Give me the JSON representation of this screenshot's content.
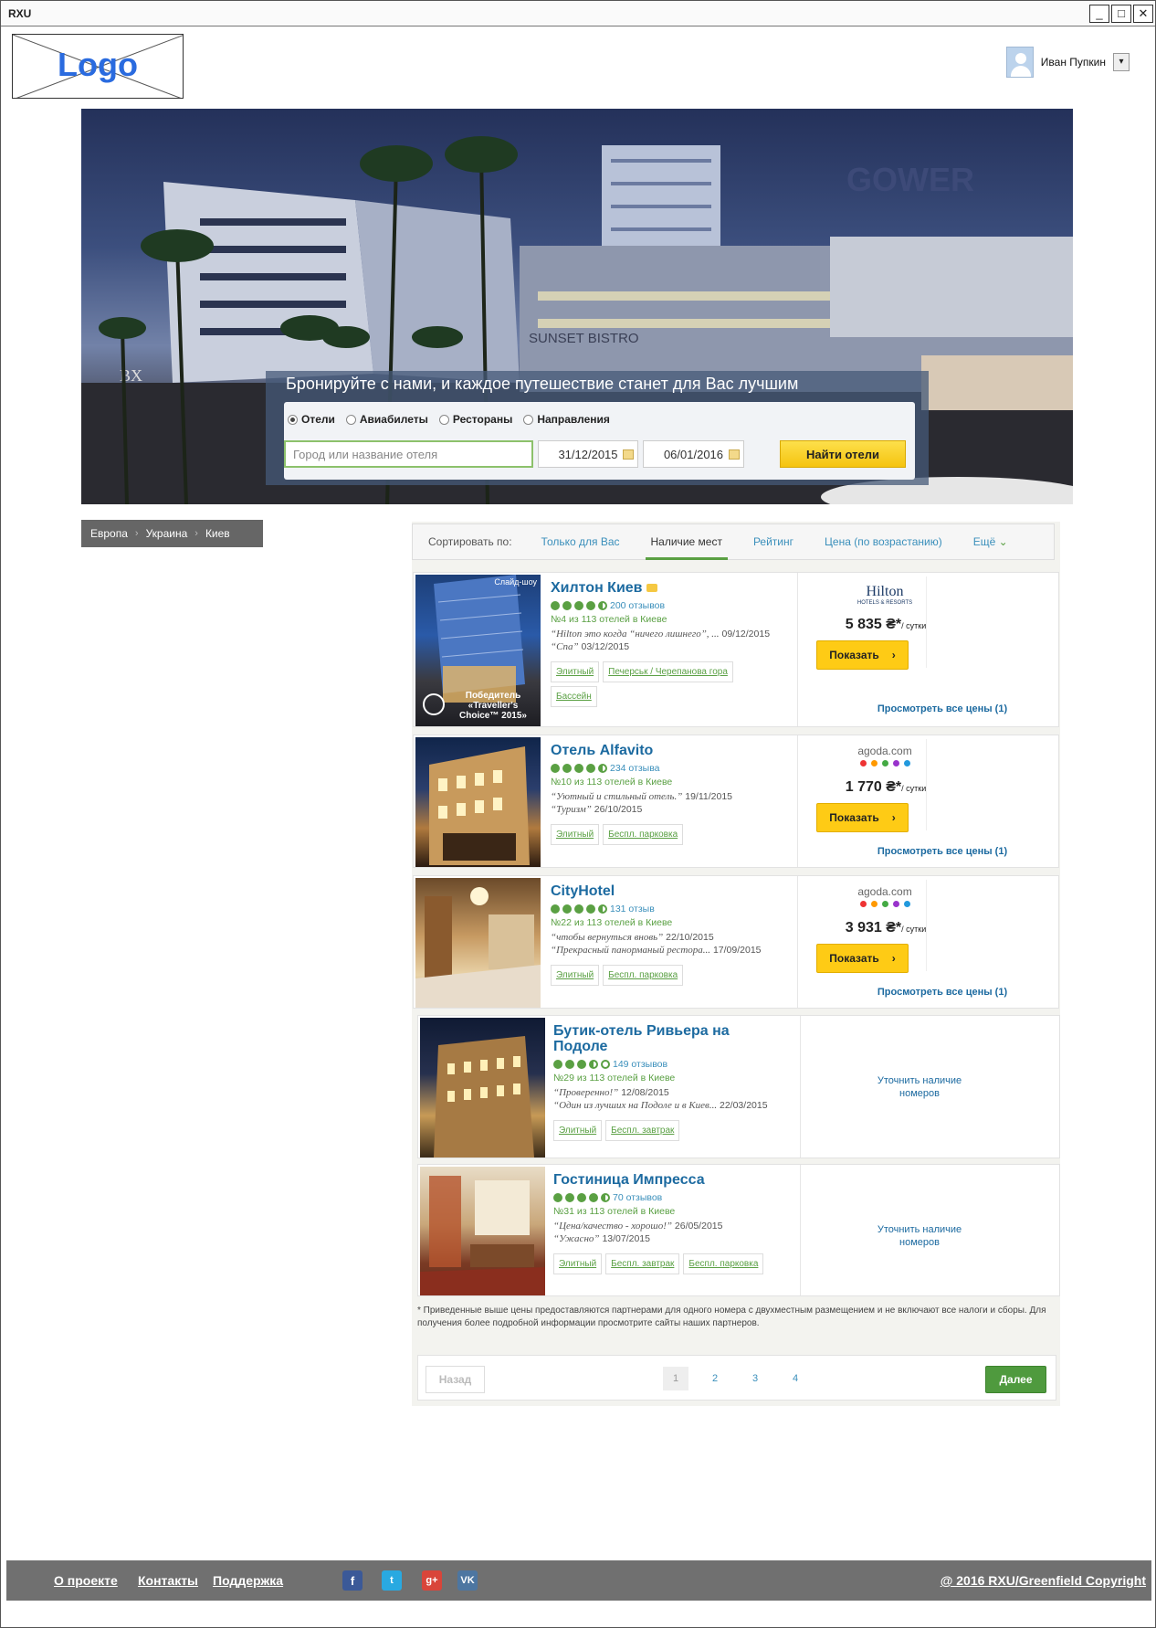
{
  "window": {
    "title": "RXU",
    "min": "_",
    "max": "□",
    "close": "✕"
  },
  "header": {
    "logo_text": "Logo",
    "user_name": "Иван Пупкин",
    "dropdown_arrow": "▾"
  },
  "hero": {
    "headline": "Бронируйте с нами, и каждое путешествие станет для Вас лучшим",
    "tabs": [
      "Отели",
      "Авиабилеты",
      "Рестораны",
      "Направления"
    ],
    "selected_tab": "Отели",
    "city_placeholder": "Город или название отеля",
    "checkin": "31/12/2015",
    "checkout": "06/01/2016",
    "search_button": "Найти отели"
  },
  "breadcrumb": [
    "Европа",
    "Украина",
    "Киев"
  ],
  "breadcrumb_sep": "›",
  "sort": {
    "label": "Сортировать по:",
    "options": [
      "Только для Вас",
      "Наличие мест",
      "Рейтинг",
      "Цена (по возрастанию)",
      "Ещё"
    ],
    "active": "Наличие мест",
    "more_arrow": "⌄"
  },
  "hotels": [
    {
      "name": "Хилтон Киев",
      "rating": 4.5,
      "reviews": "200 отзывов",
      "rank": "№4 из 113 отелей в Киеве",
      "review1": "“Hilton это когда “ничего лишнего”, ...",
      "date1": "09/12/2015",
      "review2": "“Спа”",
      "date2": "03/12/2015",
      "tags": [
        "Элитный",
        "Печерськ / Черепанова гора",
        "Бассейн"
      ],
      "partner": "Hilton",
      "partner_sub": "HOTELS & RESORTS",
      "price": "5 835 ₴*",
      "per": "/ сутки",
      "show": "Показать",
      "all_prices": "Просмотреть все цены (1)",
      "badge": "Слайд-шоу",
      "award": "Победитель «Traveller's Choice™ 2015»"
    },
    {
      "name": "Отель Alfavito",
      "rating": 4.5,
      "reviews": "234 отзыва",
      "rank": "№10 из 113 отелей в Киеве",
      "review1": "“Уютный и стильный отель.”",
      "date1": "19/11/2015",
      "review2": "“Туризм”",
      "date2": "26/10/2015",
      "tags": [
        "Элитный",
        "Беспл. парковка"
      ],
      "partner": "agoda.com",
      "price": "1 770 ₴*",
      "per": "/ сутки",
      "show": "Показать",
      "all_prices": "Просмотреть все цены (1)"
    },
    {
      "name": "CityHotel",
      "rating": 4.5,
      "reviews": "131 отзыв",
      "rank": "№22 из 113 отелей в Киеве",
      "review1": "“чтобы вернуться вновь”",
      "date1": "22/10/2015",
      "review2": "“Прекрасный панорманый рестора...",
      "date2": "17/09/2015",
      "tags": [
        "Элитный",
        "Беспл. парковка"
      ],
      "partner": "agoda.com",
      "price": "3 931 ₴*",
      "per": "/ сутки",
      "show": "Показать",
      "all_prices": "Просмотреть все цены (1)"
    },
    {
      "name": "Бутик-отель Ривьера на Подоле",
      "rating": 3.5,
      "reviews": "149 отзывов",
      "rank": "№29 из 113 отелей в Киеве",
      "review1": "“Проверенно!”",
      "date1": "12/08/2015",
      "review2": "“Один из лучших на Подоле и в Киев...",
      "date2": "22/03/2015",
      "tags": [
        "Элитный",
        "Беспл. завтрак"
      ],
      "clarify": "Уточнить наличие номеров"
    },
    {
      "name": "Гостиница Импресса",
      "rating": 4.5,
      "reviews": "70 отзывов",
      "rank": "№31 из 113 отелей в Киеве",
      "review1": "“Цена/качество - хорошо!”",
      "date1": "26/05/2015",
      "review2": "“Ужасно”",
      "date2": "13/07/2015",
      "tags": [
        "Элитный",
        "Беспл. завтрак",
        "Беспл. парковка"
      ],
      "clarify": "Уточнить наличие номеров"
    }
  ],
  "footnote": "* Приведенные выше цены предоставляются партнерами для одного номера с двухместным размещением и не включают все налоги и сборы. Для получения более подробной информации просмотрите сайты наших партнеров.",
  "pagination": {
    "prev": "Назад",
    "pages": [
      "1",
      "2",
      "3",
      "4"
    ],
    "current": "1",
    "next": "Далее"
  },
  "footer": {
    "links": [
      "О проекте",
      "Контакты",
      "Поддержка"
    ],
    "social": [
      "f",
      "t",
      "g+",
      "VK"
    ],
    "copyright": "@ 2016 RXU/Greenfield Copyright"
  },
  "colors": {
    "accent_green": "#5aa043",
    "link_blue": "#1c6aa0",
    "button_yellow": "#fecb15",
    "footer_gray": "#707070"
  }
}
